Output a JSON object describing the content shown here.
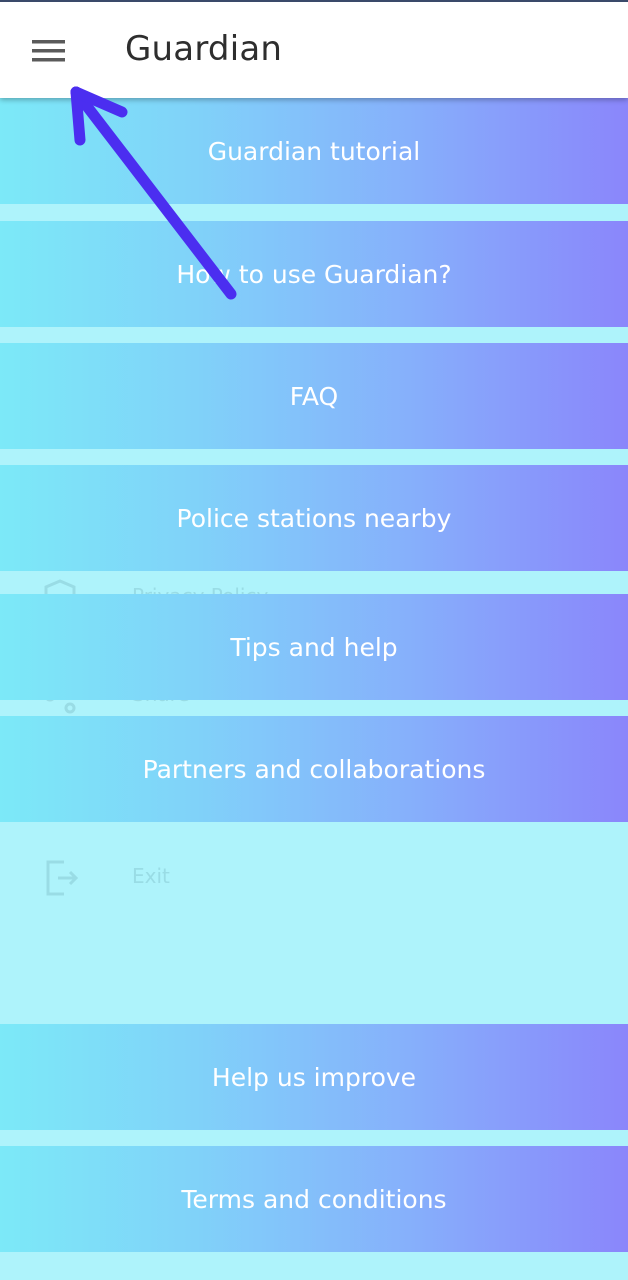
{
  "app_bar": {
    "title": "Guardian",
    "menu_icon": "hamburger-menu-icon"
  },
  "banners": [
    {
      "label": "Guardian tutorial"
    },
    {
      "label": "How to use Guardian?"
    },
    {
      "label": "FAQ"
    },
    {
      "label": "Police stations nearby"
    },
    {
      "label": "Tips and help"
    },
    {
      "label": "Partners and collaborations"
    },
    {
      "label": "Help us improve"
    },
    {
      "label": "Terms and conditions"
    }
  ],
  "background_drawer": {
    "items": [
      {
        "label": "Privacy Policy",
        "icon": "shield-icon"
      },
      {
        "label": "Share",
        "icon": "share-icon"
      },
      {
        "label": "Exit",
        "icon": "exit-icon"
      }
    ]
  },
  "annotation": {
    "icon": "pointer-arrow-icon",
    "color": "#4b2ef0"
  },
  "colors": {
    "gradient_start": "#7ce9f8",
    "gradient_end": "#8a86fb",
    "background": "#aef3fb"
  }
}
